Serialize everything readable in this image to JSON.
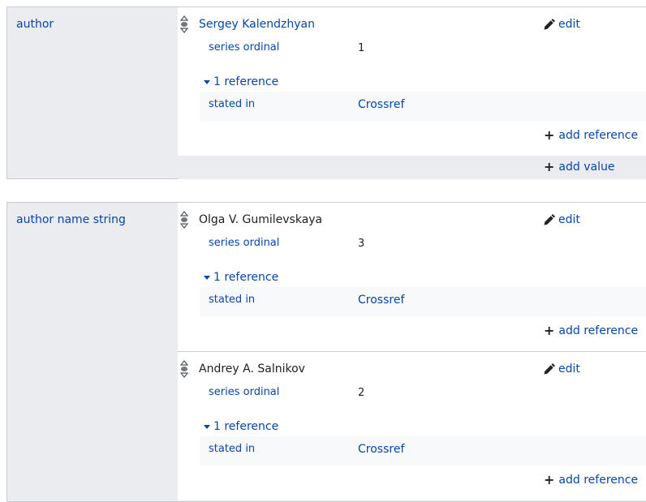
{
  "groups": [
    {
      "property": "author",
      "statements": [
        {
          "value": "Sergey Kalendzhyan",
          "value_is_link": true,
          "edit_label": "edit",
          "qualifier_property": "series ordinal",
          "qualifier_value": "1",
          "references_toggle": "1 reference",
          "reference_property": "stated in",
          "reference_value": "Crossref",
          "add_reference_label": "add reference"
        }
      ],
      "add_value_label": "add value"
    },
    {
      "property": "author name string",
      "statements": [
        {
          "value": "Olga V. Gumilevskaya",
          "value_is_link": false,
          "edit_label": "edit",
          "qualifier_property": "series ordinal",
          "qualifier_value": "3",
          "references_toggle": "1 reference",
          "reference_property": "stated in",
          "reference_value": "Crossref",
          "add_reference_label": "add reference"
        },
        {
          "value": "Andrey A. Salnikov",
          "value_is_link": false,
          "edit_label": "edit",
          "qualifier_property": "series ordinal",
          "qualifier_value": "2",
          "references_toggle": "1 reference",
          "reference_property": "stated in",
          "reference_value": "Crossref",
          "add_reference_label": "add reference"
        }
      ]
    }
  ],
  "colors": {
    "link": "#0645ad",
    "text": "#202122",
    "group_bg": "#eaecf0",
    "border": "#c8ccd1",
    "reference_bg": "#f8f9fa"
  },
  "icons": {
    "rank": "normal-rank-icon",
    "edit": "pencil-icon",
    "add": "plus-icon",
    "expand": "triangle-down-icon"
  }
}
